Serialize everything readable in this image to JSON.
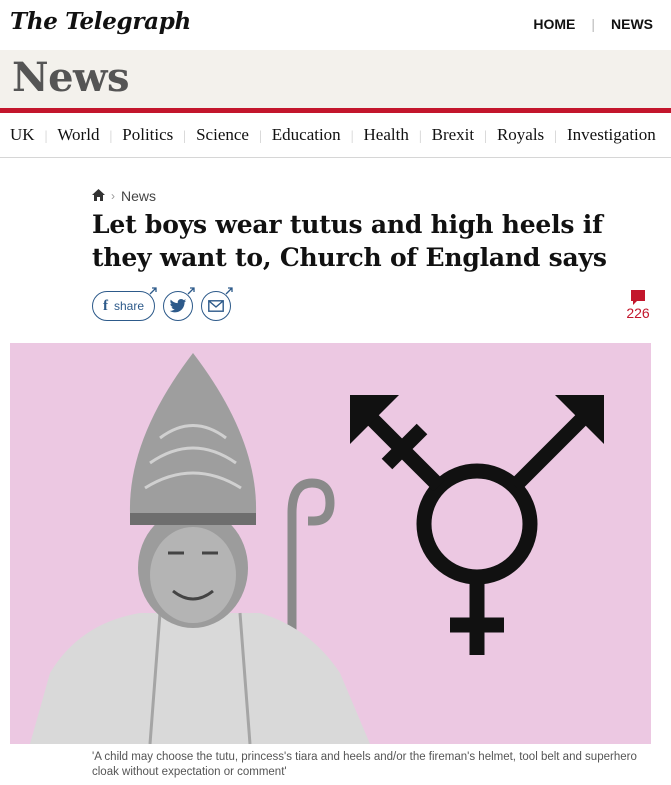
{
  "masthead": {
    "logo": "The Telegraph",
    "nav": [
      "HOME",
      "NEWS"
    ]
  },
  "section": {
    "title": "News"
  },
  "subnav": [
    "UK",
    "World",
    "Politics",
    "Science",
    "Education",
    "Health",
    "Brexit",
    "Royals",
    "Investigation"
  ],
  "breadcrumb": {
    "home_icon": "home-icon",
    "current": "News"
  },
  "article": {
    "headline": "Let boys wear tutus and high heels if they want to, Church of England says",
    "share_label": "share",
    "comment_count": "226",
    "caption": "'A child may choose the tutu, princess's tiara and heels and/or the fireman's helmet, tool belt and superhero cloak without expectation or comment'"
  },
  "colors": {
    "brand_red": "#c3162c",
    "share_blue": "#2d5a8a",
    "hero_pink": "#ecc8e2",
    "section_band": "#f3f1ec"
  }
}
